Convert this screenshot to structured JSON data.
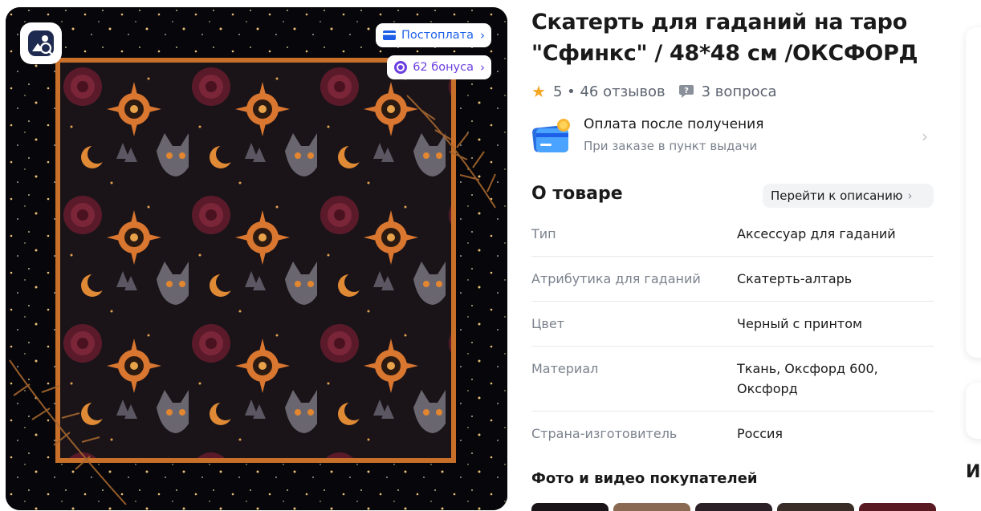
{
  "gallery": {
    "badges": {
      "postpay_label": "Постоплата",
      "bonus_label": "62 бонуса"
    },
    "icons": [
      "search-similar-icon",
      "card-icon",
      "bonus-coin-icon",
      "chevron-right-icon"
    ]
  },
  "product": {
    "title": "Скатерть для гаданий на таро \"Сфинкс\" / 48*48 см /ОКСФОРД",
    "rating": "5",
    "reviews": "• 46 отзывов",
    "questions": "3 вопроса"
  },
  "payment": {
    "title": "Оплата после получения",
    "subtitle": "При заказе в пункт выдачи"
  },
  "about": {
    "title": "О товаре",
    "description_link": "Перейти к описанию",
    "specs": [
      {
        "key": "Тип",
        "value": "Аксессуар для гаданий"
      },
      {
        "key": "Атрибутика для гаданий",
        "value": "Скатерть-алтарь"
      },
      {
        "key": "Цвет",
        "value": "Черный с принтом"
      },
      {
        "key": "Материал",
        "value": "Ткань, Оксфорд 600, Оксфорд"
      },
      {
        "key": "Страна-изготовитель",
        "value": "Россия"
      }
    ]
  },
  "customer_media": {
    "title": "Фото и видео покупателей"
  },
  "side": {
    "partial_heading": "И"
  },
  "colors": {
    "accent_blue": "#1d5fe8",
    "bonus_purple": "#6b3fe0",
    "star": "#f5a623",
    "muted_text": "#7b828d",
    "cloth_border": "#c8702a",
    "cloth_bg": "#1a1418"
  }
}
